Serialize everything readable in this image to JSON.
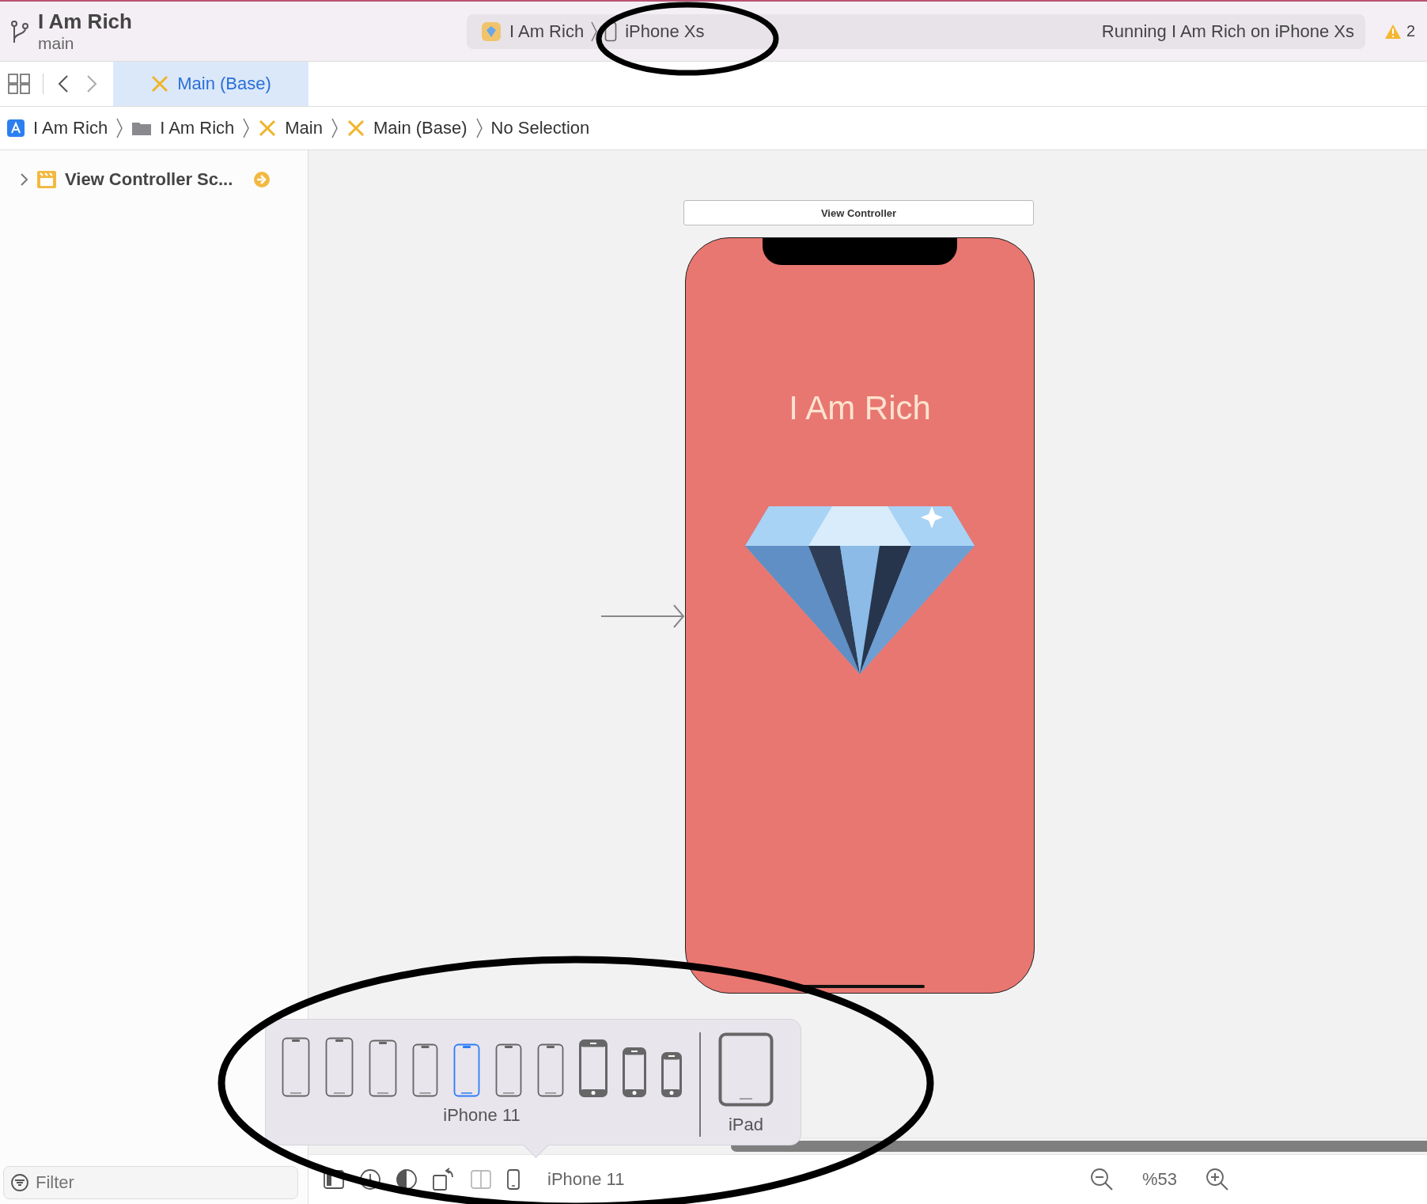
{
  "toolbar": {
    "project": "I Am Rich",
    "branch": "main",
    "scheme": "I Am Rich",
    "destination": "iPhone Xs",
    "status": "Running I Am Rich on iPhone Xs",
    "warnings": "2"
  },
  "tabs": [
    {
      "label": "Main (Base)",
      "selected": true
    }
  ],
  "breadcrumb": [
    {
      "label": "I Am Rich",
      "kind": "app"
    },
    {
      "label": "I Am Rich",
      "kind": "folder"
    },
    {
      "label": "Main",
      "kind": "storyboard"
    },
    {
      "label": "Main (Base)",
      "kind": "storyboard"
    },
    {
      "label": "No Selection",
      "kind": "plain"
    }
  ],
  "outline": [
    {
      "label": "View Controller Sc...",
      "expanded": false
    }
  ],
  "filter": {
    "placeholder": "Filter"
  },
  "canvas": {
    "scene_title": "View Controller",
    "app_title": "I Am Rich"
  },
  "device_popup": {
    "devices": [
      {
        "kind": "notch",
        "selected": false
      },
      {
        "kind": "notch",
        "selected": false
      },
      {
        "kind": "notch",
        "selected": false
      },
      {
        "kind": "notch",
        "selected": false
      },
      {
        "kind": "notch",
        "selected": true
      },
      {
        "kind": "notch",
        "selected": false
      },
      {
        "kind": "notch",
        "selected": false
      },
      {
        "kind": "home",
        "selected": false
      },
      {
        "kind": "home",
        "selected": false
      },
      {
        "kind": "home",
        "selected": false
      }
    ],
    "phone_label": "iPhone 11",
    "ipad_label": "iPad"
  },
  "bottom_bar": {
    "device": "iPhone 11",
    "zoom": "%53"
  }
}
